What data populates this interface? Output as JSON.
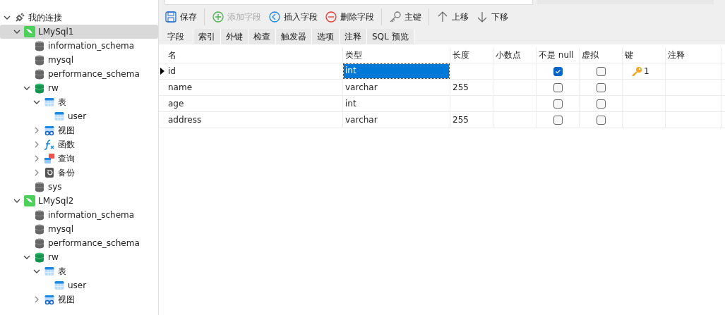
{
  "sidebar": {
    "tree": [
      {
        "label": "我的连接",
        "kind": "group",
        "expanded": true,
        "children": [
          {
            "label": "LMySql1",
            "kind": "connection",
            "expanded": true,
            "selected": true,
            "children": [
              {
                "label": "information_schema",
                "kind": "database",
                "selected": false
              },
              {
                "label": "mysql",
                "kind": "database",
                "selected": false
              },
              {
                "label": "performance_schema",
                "kind": "database",
                "selected": false
              },
              {
                "label": "rw",
                "kind": "database-open",
                "expanded": true,
                "selected": false,
                "children": [
                  {
                    "label": "表",
                    "kind": "tables",
                    "expanded": true,
                    "selected": false,
                    "children": [
                      {
                        "label": "user",
                        "kind": "table",
                        "selected": false
                      }
                    ]
                  },
                  {
                    "label": "视图",
                    "kind": "views",
                    "expanded": false,
                    "selected": false
                  },
                  {
                    "label": "函数",
                    "kind": "functions",
                    "expanded": false,
                    "selected": false
                  },
                  {
                    "label": "查询",
                    "kind": "queries",
                    "expanded": false,
                    "selected": false
                  },
                  {
                    "label": "备份",
                    "kind": "backups",
                    "expanded": false,
                    "selected": false
                  }
                ]
              },
              {
                "label": "sys",
                "kind": "database",
                "selected": false
              }
            ]
          },
          {
            "label": "LMySql2",
            "kind": "connection",
            "expanded": true,
            "selected": false,
            "children": [
              {
                "label": "information_schema",
                "kind": "database",
                "selected": false
              },
              {
                "label": "mysql",
                "kind": "database",
                "selected": false
              },
              {
                "label": "performance_schema",
                "kind": "database",
                "selected": false
              },
              {
                "label": "rw",
                "kind": "database-open",
                "expanded": true,
                "selected": false,
                "children": [
                  {
                    "label": "表",
                    "kind": "tables",
                    "expanded": true,
                    "selected": false,
                    "children": [
                      {
                        "label": "user",
                        "kind": "table",
                        "selected": false
                      }
                    ]
                  },
                  {
                    "label": "视图",
                    "kind": "views",
                    "expanded": false,
                    "selected": false
                  }
                ]
              }
            ]
          }
        ]
      }
    ]
  },
  "toolbar": [
    {
      "label": "保存",
      "kind": "save",
      "disabled": false
    },
    {
      "label": "添加字段",
      "kind": "add",
      "disabled": true
    },
    {
      "label": "插入字段",
      "kind": "insert",
      "disabled": false
    },
    {
      "label": "删除字段",
      "kind": "delete",
      "disabled": false
    },
    {
      "label": "主键",
      "kind": "key",
      "disabled": false
    },
    {
      "label": "上移",
      "kind": "up",
      "disabled": false
    },
    {
      "label": "下移",
      "kind": "down",
      "disabled": false
    }
  ],
  "tabs": [
    {
      "label": "字段",
      "selected": true
    },
    {
      "label": "索引",
      "selected": false
    },
    {
      "label": "外键",
      "selected": false
    },
    {
      "label": "检查",
      "selected": false
    },
    {
      "label": "触发器",
      "selected": false
    },
    {
      "label": "选项",
      "selected": false
    },
    {
      "label": "注释",
      "selected": false
    },
    {
      "label": "SQL 预览",
      "selected": false
    }
  ],
  "table": {
    "columns": [
      "名",
      "类型",
      "长度",
      "小数点",
      "不是 null",
      "虚拟",
      "键",
      "注释"
    ],
    "rows": [
      {
        "name": "id",
        "type": "int",
        "length": "",
        "not_null": true,
        "virtual": false,
        "key": "1",
        "current": true
      },
      {
        "name": "name",
        "type": "varchar",
        "length": "255",
        "not_null": false,
        "virtual": false,
        "current": false
      },
      {
        "name": "age",
        "type": "int",
        "length": "",
        "not_null": false,
        "virtual": false,
        "current": false
      },
      {
        "name": "address",
        "type": "varchar",
        "length": "255",
        "not_null": false,
        "virtual": false,
        "current": false
      }
    ]
  }
}
